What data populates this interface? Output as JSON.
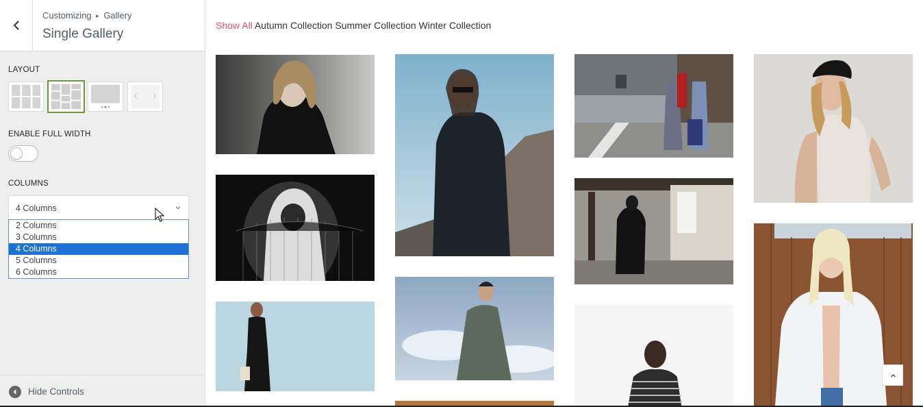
{
  "customizer": {
    "breadcrumb": {
      "root": "Customizing",
      "separator": "▸",
      "parent": "Gallery"
    },
    "section_title": "Single Gallery",
    "layout": {
      "label": "LAYOUT",
      "options": [
        {
          "name": "grid"
        },
        {
          "name": "masonry",
          "selected": true
        },
        {
          "name": "slider"
        },
        {
          "name": "carousel"
        }
      ]
    },
    "full_width": {
      "label": "ENABLE FULL WIDTH",
      "enabled": false
    },
    "columns": {
      "label": "COLUMNS",
      "selected": "4 Columns",
      "options": [
        "2 Columns",
        "3 Columns",
        "4 Columns",
        "5 Columns",
        "6 Columns"
      ]
    },
    "footer": {
      "hide_label": "Hide Controls"
    }
  },
  "preview": {
    "filters": [
      "Show All",
      "Autumn Collection",
      "Summer Collection",
      "Winter Collection"
    ],
    "active_filter": "Show All",
    "accent_color": "#e94e6f",
    "images": [
      {
        "name": "woman-blonde-black-jacket"
      },
      {
        "name": "hooded-figure-bw-fence"
      },
      {
        "name": "woman-black-jumpsuit"
      },
      {
        "name": "woman-sunglasses-rocks-sea"
      },
      {
        "name": "man-green-jacket-sky"
      },
      {
        "name": "two-women-street-suitcase"
      },
      {
        "name": "man-black-coat-warehouse"
      },
      {
        "name": "man-striped-sweater"
      },
      {
        "name": "woman-cap-white-tank"
      },
      {
        "name": "woman-white-shirt-wood"
      }
    ]
  }
}
